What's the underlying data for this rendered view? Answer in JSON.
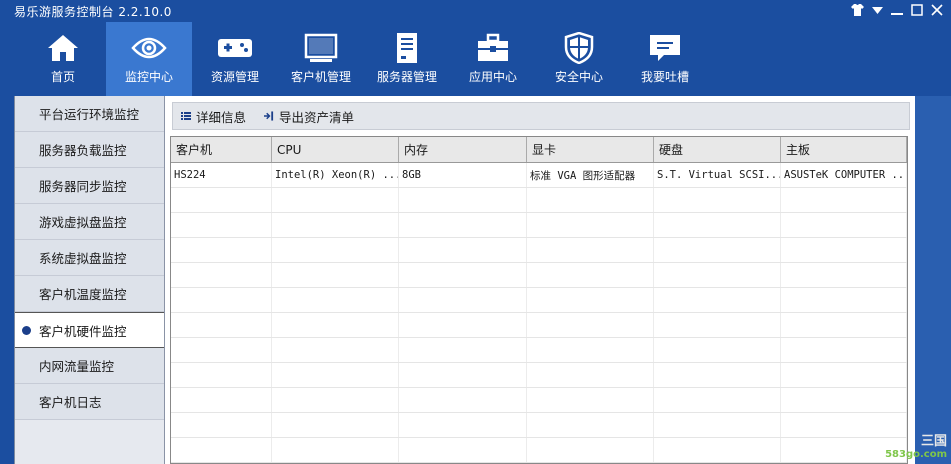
{
  "window": {
    "title": "易乐游服务控制台 2.2.10.0",
    "controls": [
      "shirt-icon",
      "dropdown-icon",
      "minimize-icon",
      "maximize-icon",
      "close-icon"
    ]
  },
  "colors": {
    "header": "#1b4ea0",
    "active_nav": "#3a78d0",
    "accent_dot": "#1b3f8a"
  },
  "nav": {
    "items": [
      {
        "label": "首页",
        "icon": "home-icon"
      },
      {
        "label": "监控中心",
        "icon": "eye-icon",
        "active": true
      },
      {
        "label": "资源管理",
        "icon": "gamepad-icon"
      },
      {
        "label": "客户机管理",
        "icon": "monitor-icon"
      },
      {
        "label": "服务器管理",
        "icon": "server-icon"
      },
      {
        "label": "应用中心",
        "icon": "toolbox-icon"
      },
      {
        "label": "安全中心",
        "icon": "shield-icon"
      },
      {
        "label": "我要吐槽",
        "icon": "chat-icon"
      }
    ]
  },
  "sidebar": {
    "items": [
      {
        "label": "平台运行环境监控"
      },
      {
        "label": "服务器负载监控"
      },
      {
        "label": "服务器同步监控"
      },
      {
        "label": "游戏虚拟盘监控"
      },
      {
        "label": "系统虚拟盘监控"
      },
      {
        "label": "客户机温度监控"
      },
      {
        "label": "客户机硬件监控",
        "active": true
      },
      {
        "label": "内网流量监控"
      },
      {
        "label": "客户机日志"
      }
    ]
  },
  "toolbar": {
    "details_label": "详细信息",
    "export_label": "导出资产清单"
  },
  "table": {
    "columns": [
      "客户机",
      "CPU",
      "内存",
      "显卡",
      "硬盘",
      "主板"
    ],
    "rows": [
      [
        "HS224",
        "Intel(R) Xeon(R) ...",
        "8GB",
        "标准 VGA 图形适配器",
        "S.T. Virtual SCSI...",
        "ASUSTeK COMPUTER ..."
      ]
    ]
  },
  "watermark": {
    "line1": "三国",
    "line2": "583go.com"
  }
}
